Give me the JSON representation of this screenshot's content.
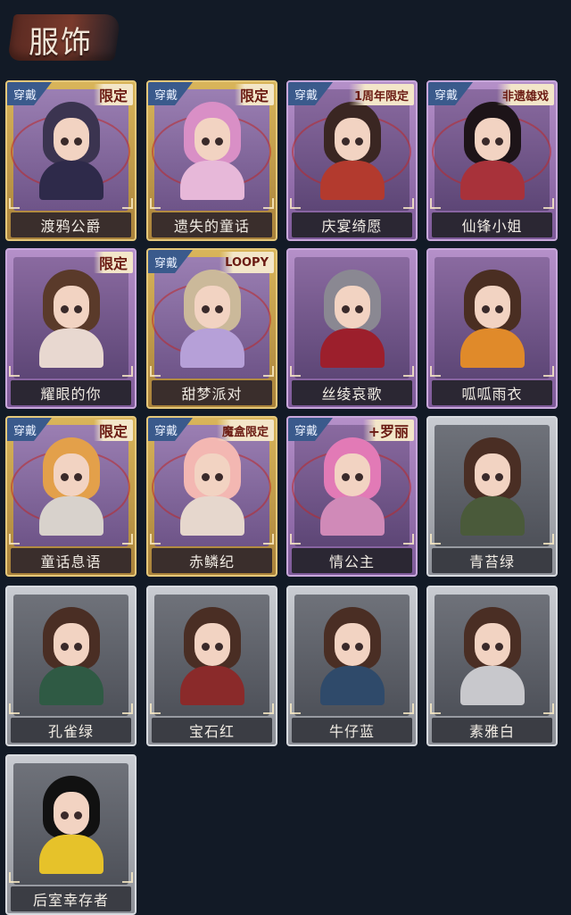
{
  "header": {
    "title": "服饰"
  },
  "labels": {
    "equipped": "穿戴"
  },
  "costumes": [
    {
      "name": "渡鸦公爵",
      "frame": "gold",
      "equipped": true,
      "badge": "限定",
      "hair": "#3b3450",
      "outfit": "#2e2a4a"
    },
    {
      "name": "遗失的童话",
      "frame": "gold",
      "equipped": true,
      "badge": "限定",
      "hair": "#d98fc6",
      "outfit": "#e7b8d9"
    },
    {
      "name": "庆宴绮愿",
      "frame": "purple",
      "equipped": true,
      "badge": "1周年限定",
      "hair": "#3a2622",
      "outfit": "#b33a2e"
    },
    {
      "name": "仙锋小姐",
      "frame": "purple",
      "equipped": true,
      "badge": "非遗雄戏",
      "hair": "#1d1418",
      "outfit": "#a8323a"
    },
    {
      "name": "耀眼的你",
      "frame": "purple",
      "equipped": false,
      "badge": "限定",
      "hair": "#5a3a2a",
      "outfit": "#e8d8d0"
    },
    {
      "name": "甜梦派对",
      "frame": "gold",
      "equipped": true,
      "badge": "LOOPY",
      "hair": "#cbb99a",
      "outfit": "#b6a0d8"
    },
    {
      "name": "丝绫哀歌",
      "frame": "purple",
      "equipped": false,
      "badge": "",
      "hair": "#8a8892",
      "outfit": "#9c1f2c"
    },
    {
      "name": "呱呱雨衣",
      "frame": "purple",
      "equipped": false,
      "badge": "",
      "hair": "#4a2e22",
      "outfit": "#e08a2a"
    },
    {
      "name": "童话息语",
      "frame": "gold",
      "equipped": true,
      "badge": "限定",
      "hair": "#e3a04a",
      "outfit": "#d8d2cc"
    },
    {
      "name": "赤鳞纪",
      "frame": "gold",
      "equipped": true,
      "badge": "魔盒限定",
      "hair": "#f3b7b2",
      "outfit": "#e6d7cd"
    },
    {
      "name": "情公主",
      "frame": "purple",
      "equipped": true,
      "badge": "+罗丽",
      "hair": "#e27ab6",
      "outfit": "#d08ab8"
    },
    {
      "name": "青苔绿",
      "frame": "gray",
      "equipped": false,
      "badge": "",
      "hair": "#4a2e24",
      "outfit": "#4a5a3a"
    },
    {
      "name": "孔雀绿",
      "frame": "gray",
      "equipped": false,
      "badge": "",
      "hair": "#4a2e24",
      "outfit": "#2f5a44"
    },
    {
      "name": "宝石红",
      "frame": "gray",
      "equipped": false,
      "badge": "",
      "hair": "#4a2e24",
      "outfit": "#8a2a2a"
    },
    {
      "name": "牛仔蓝",
      "frame": "gray",
      "equipped": false,
      "badge": "",
      "hair": "#4a2e24",
      "outfit": "#2f4a6a"
    },
    {
      "name": "素雅白",
      "frame": "gray",
      "equipped": false,
      "badge": "",
      "hair": "#4a2e24",
      "outfit": "#c8c8cc"
    },
    {
      "name": "后室幸存者",
      "frame": "gray",
      "equipped": false,
      "badge": "",
      "hair": "#111111",
      "outfit": "#e6c22a"
    }
  ]
}
